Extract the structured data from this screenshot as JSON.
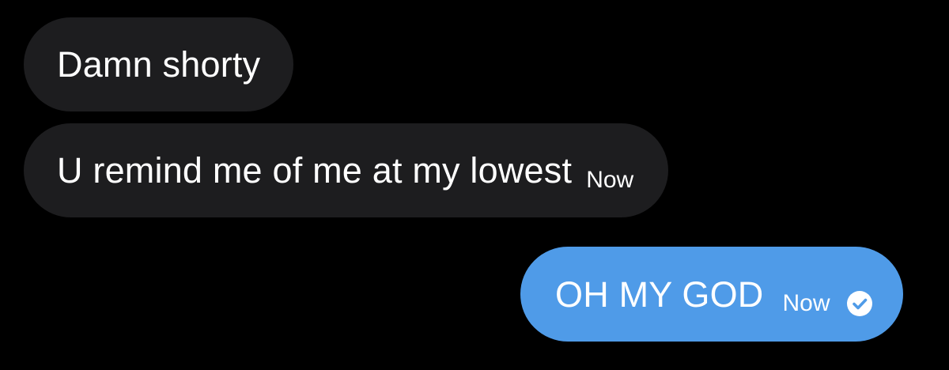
{
  "messages": [
    {
      "direction": "incoming",
      "text": "Damn shorty",
      "timestamp": ""
    },
    {
      "direction": "incoming",
      "text": "U remind me of me at my lowest",
      "timestamp": "Now"
    },
    {
      "direction": "outgoing",
      "text": "OH MY GOD",
      "timestamp": "Now",
      "receipt_icon": "check-circle-icon"
    }
  ],
  "colors": {
    "background": "#000000",
    "incoming_bubble": "#1d1d1f",
    "outgoing_bubble": "#4f9be8",
    "text": "#ffffff"
  }
}
